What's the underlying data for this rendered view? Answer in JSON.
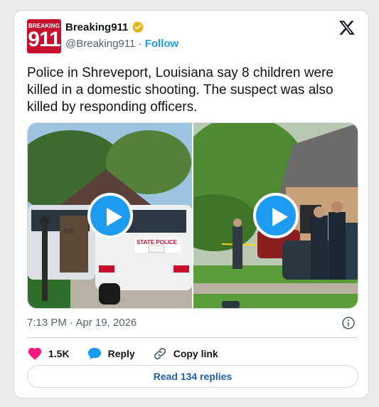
{
  "author": {
    "avatar_top_text": "BREAKING",
    "avatar_number": "911",
    "display_name": "Breaking911",
    "handle": "@Breaking911",
    "separator": "·",
    "follow_label": "Follow",
    "verified_icon": "gold-verified-badge-icon"
  },
  "tweet": {
    "text": "Police in Shreveport, Louisiana say 8 children were killed in a domestic shooting. The suspect was also killed by responding officers.",
    "timestamp": "7:13 PM · Apr 19, 2026"
  },
  "media": [
    {
      "type": "video",
      "icon": "play-icon",
      "description_icon": "police-suv-scene"
    },
    {
      "type": "video",
      "icon": "play-icon",
      "description_icon": "officers-at-house-scene"
    }
  ],
  "media_text": {
    "vehicle_number": "499",
    "state_police": "STATE POLICE"
  },
  "actions": {
    "like_count": "1.5K",
    "reply_label": "Reply",
    "copy_link_label": "Copy link"
  },
  "read_replies_label": "Read 134 replies",
  "colors": {
    "accent": "#1d9bf0",
    "like": "#f91880",
    "brand_red": "#c8102e",
    "verified_gold": "#e2b719"
  }
}
